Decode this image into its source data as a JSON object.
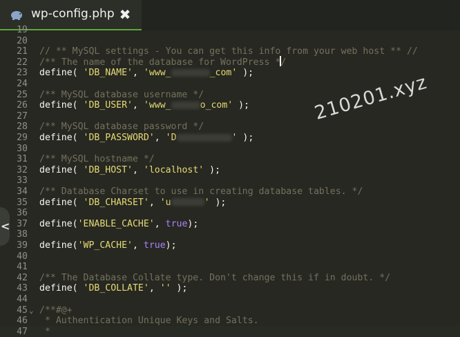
{
  "tab": {
    "title": "wp-config.php",
    "close_glyph": "✖",
    "icon": "elephant-php-icon"
  },
  "watermark": "210201.xyz",
  "sidebar_toggle": {
    "glyph": "<",
    "icon": "chevron-left-icon"
  },
  "lines": [
    {
      "n": "19",
      "text": ""
    },
    {
      "n": "20",
      "text": ""
    },
    {
      "n": "21",
      "text": "// ** MySQL settings - You can get this info from your web host ** //",
      "kind": "comment"
    },
    {
      "n": "22",
      "text": "/** The name of the database for WordPress */",
      "kind": "comment"
    },
    {
      "n": "23",
      "prefix": "define( ",
      "key": "'DB_NAME'",
      "sep": ", ",
      "value": "'www_",
      "value2": "_com'",
      "suffix": " );"
    },
    {
      "n": "24",
      "text": ""
    },
    {
      "n": "25",
      "text": "/** MySQL database username */",
      "kind": "comment"
    },
    {
      "n": "26",
      "prefix": "define( ",
      "key": "'DB_USER'",
      "sep": ", ",
      "value": "'www_",
      "value2": "o_com'",
      "suffix": " );"
    },
    {
      "n": "27",
      "text": ""
    },
    {
      "n": "28",
      "text": "/** MySQL database password */",
      "kind": "comment"
    },
    {
      "n": "29",
      "prefix": "define( ",
      "key": "'DB_PASSWORD'",
      "sep": ", ",
      "value": "'D",
      "value2": "'",
      "suffix": " );"
    },
    {
      "n": "30",
      "text": ""
    },
    {
      "n": "31",
      "text": "/** MySQL hostname */",
      "kind": "comment"
    },
    {
      "n": "32",
      "prefix": "define( ",
      "key": "'DB_HOST'",
      "sep": ", ",
      "value": "'localhost'",
      "suffix": " );"
    },
    {
      "n": "33",
      "text": ""
    },
    {
      "n": "34",
      "text": "/** Database Charset to use in creating database tables. */",
      "kind": "comment"
    },
    {
      "n": "35",
      "prefix": "define( ",
      "key": "'DB_CHARSET'",
      "sep": ", ",
      "value": "'u",
      "value2": "'",
      "suffix": " );"
    },
    {
      "n": "36",
      "text": ""
    },
    {
      "n": "37",
      "prefix": "define(",
      "key": "'ENABLE_CACHE'",
      "sep": ", ",
      "bool": "true",
      "suffix": ");"
    },
    {
      "n": "38",
      "text": ""
    },
    {
      "n": "39",
      "prefix": "define(",
      "key": "'WP_CACHE'",
      "sep": ", ",
      "bool": "true",
      "suffix": ");"
    },
    {
      "n": "40",
      "text": ""
    },
    {
      "n": "41",
      "text": ""
    },
    {
      "n": "42",
      "text": "/** The Database Collate type. Don't change this if in doubt. */",
      "kind": "comment"
    },
    {
      "n": "43",
      "prefix": "define( ",
      "key": "'DB_COLLATE'",
      "sep": ", ",
      "value": "''",
      "suffix": " );"
    },
    {
      "n": "44",
      "text": ""
    },
    {
      "n": "45",
      "text": "/**#@+",
      "kind": "comment",
      "fold": "⌄"
    },
    {
      "n": "46",
      "text": " * Authentication Unique Keys and Salts.",
      "kind": "comment"
    },
    {
      "n": "47",
      "text": " *",
      "kind": "comment"
    }
  ],
  "colors": {
    "background": "#272822",
    "comment": "#75715e",
    "string": "#e6db74",
    "boolean": "#ae81ff",
    "plain": "#f8f8f2",
    "tab_accent": "#5fa83c"
  }
}
